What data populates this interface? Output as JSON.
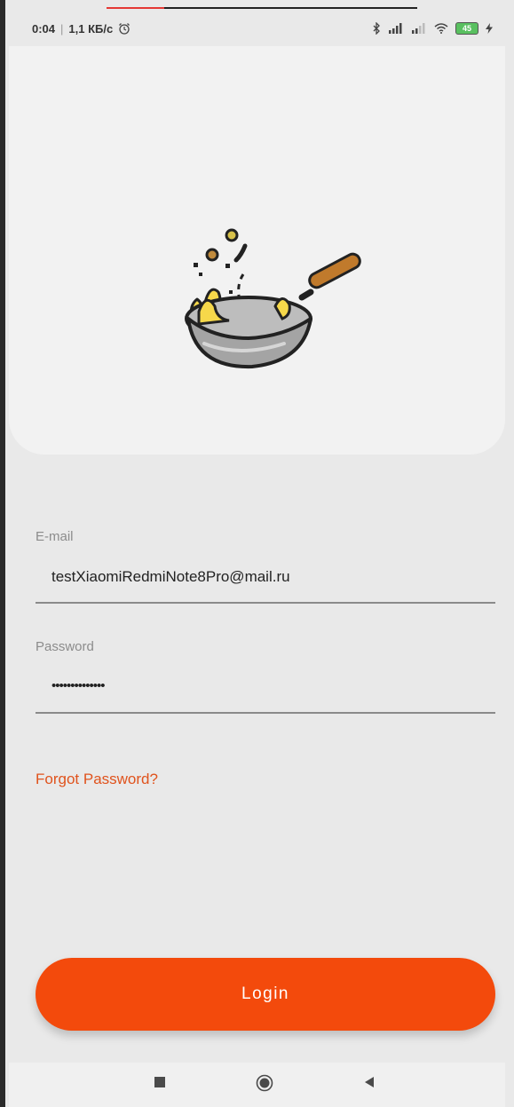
{
  "status_bar": {
    "time": "0:04",
    "speed": "1,1 КБ/с",
    "alarm_icon": "alarm-clock-icon",
    "icons": [
      "bluetooth-icon",
      "signal-icon",
      "signal-weak-icon",
      "wifi-icon"
    ],
    "battery_level": "45",
    "charging_icon": "lightning-icon"
  },
  "hero": {
    "logo_icon": "wok-cooking-icon",
    "colors": {
      "background": "#f2f2f2",
      "pan": "#9e9e9e",
      "food": "#f6d84a",
      "handle": "#c07a2c"
    }
  },
  "form": {
    "email": {
      "label": "E-mail",
      "value": "testXiaomiRedmiNote8Pro@mail.ru"
    },
    "password": {
      "label": "Password",
      "value": "••••••••••••••"
    },
    "forgot_label": "Forgot Password?"
  },
  "login": {
    "label": "Login",
    "color": "#f34a0c"
  },
  "nav": {
    "items": [
      "recent-apps-icon",
      "home-icon",
      "back-icon"
    ]
  }
}
